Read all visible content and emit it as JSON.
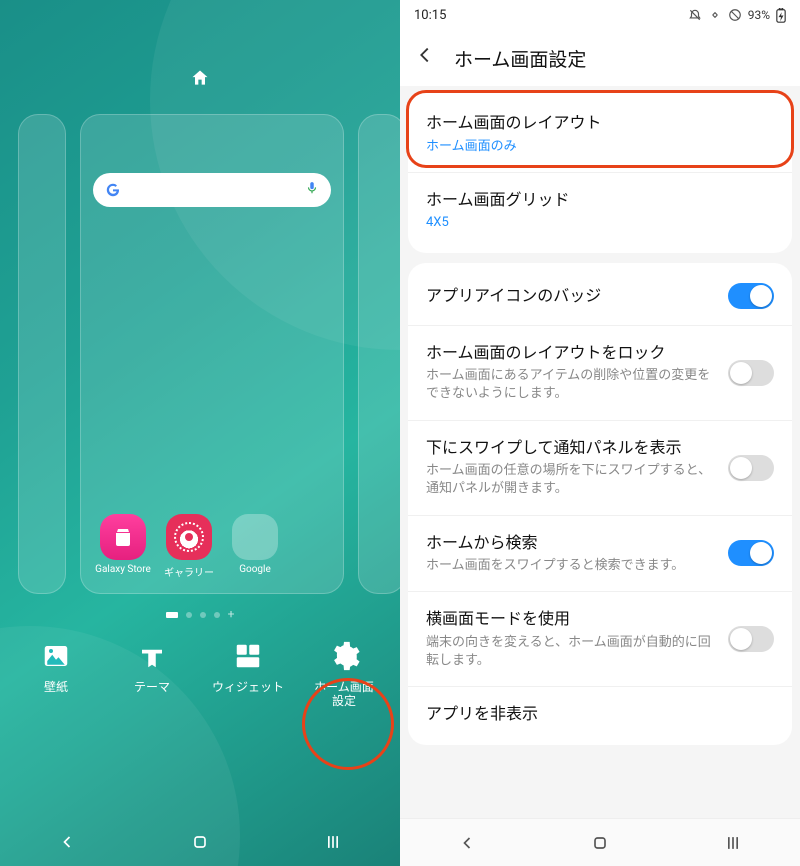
{
  "left": {
    "wallpaper_circle_home": true,
    "search_placeholder": "",
    "apps": [
      {
        "name": "galaxy-store",
        "label": "Galaxy Store",
        "color": "pink"
      },
      {
        "name": "gallery",
        "label": "ギャラリー",
        "color": "red"
      },
      {
        "name": "google-folder",
        "label": "Google",
        "color": "folder"
      }
    ],
    "page_indicator": {
      "total": 4,
      "active": 0,
      "has_add": true
    },
    "options": [
      {
        "name": "wallpaper",
        "label": "壁紙"
      },
      {
        "name": "theme",
        "label": "テーマ"
      },
      {
        "name": "widget",
        "label": "ウィジェット"
      },
      {
        "name": "home-settings",
        "label": "ホーム画面\n設定"
      }
    ],
    "highlighted_option": "home-settings"
  },
  "right": {
    "status": {
      "time": "10:15",
      "battery": "93%"
    },
    "header_title": "ホーム画面設定",
    "groups": [
      {
        "rows": [
          {
            "key": "layout",
            "title": "ホーム画面のレイアウト",
            "sub": "ホーム画面のみ",
            "sub_blue": true,
            "highlighted": true
          },
          {
            "key": "grid",
            "title": "ホーム画面グリッド",
            "sub": "4X5",
            "sub_blue": true
          }
        ]
      },
      {
        "rows": [
          {
            "key": "badge",
            "title": "アプリアイコンのバッジ",
            "toggle": true,
            "toggle_on": true
          },
          {
            "key": "lock-layout",
            "title": "ホーム画面のレイアウトをロック",
            "sub": "ホーム画面にあるアイテムの削除や位置の変更をできないようにします。",
            "toggle": true,
            "toggle_on": false
          },
          {
            "key": "swipe-notif",
            "title": "下にスワイプして通知パネルを表示",
            "sub": "ホーム画面の任意の場所を下にスワイプすると、通知パネルが開きます。",
            "toggle": true,
            "toggle_on": false
          },
          {
            "key": "search-home",
            "title": "ホームから検索",
            "sub": "ホーム画面をスワイプすると検索できます。",
            "toggle": true,
            "toggle_on": true
          },
          {
            "key": "landscape",
            "title": "横画面モードを使用",
            "sub": "端末の向きを変えると、ホーム画面が自動的に回転します。",
            "toggle": true,
            "toggle_on": false
          },
          {
            "key": "hide-apps",
            "title": "アプリを非表示"
          }
        ]
      }
    ]
  },
  "nav_labels": {
    "back": "back",
    "home": "home",
    "recents": "recents"
  }
}
